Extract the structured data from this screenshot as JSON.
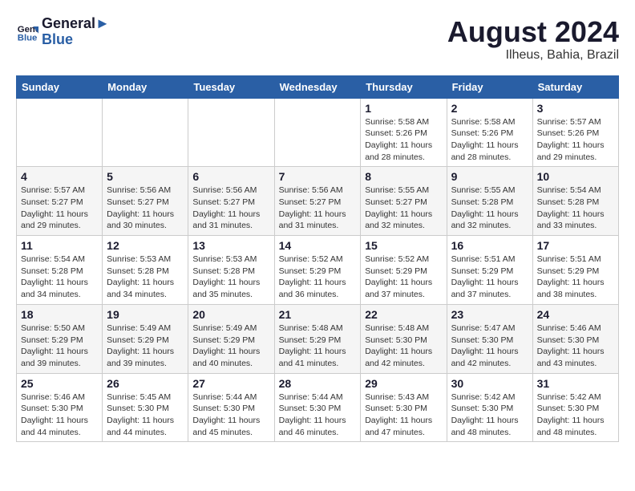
{
  "header": {
    "logo_line1": "General",
    "logo_line2": "Blue",
    "month_year": "August 2024",
    "location": "Ilheus, Bahia, Brazil"
  },
  "weekdays": [
    "Sunday",
    "Monday",
    "Tuesday",
    "Wednesday",
    "Thursday",
    "Friday",
    "Saturday"
  ],
  "weeks": [
    [
      {
        "day": "",
        "info": ""
      },
      {
        "day": "",
        "info": ""
      },
      {
        "day": "",
        "info": ""
      },
      {
        "day": "",
        "info": ""
      },
      {
        "day": "1",
        "info": "Sunrise: 5:58 AM\nSunset: 5:26 PM\nDaylight: 11 hours and 28 minutes."
      },
      {
        "day": "2",
        "info": "Sunrise: 5:58 AM\nSunset: 5:26 PM\nDaylight: 11 hours and 28 minutes."
      },
      {
        "day": "3",
        "info": "Sunrise: 5:57 AM\nSunset: 5:26 PM\nDaylight: 11 hours and 29 minutes."
      }
    ],
    [
      {
        "day": "4",
        "info": "Sunrise: 5:57 AM\nSunset: 5:27 PM\nDaylight: 11 hours and 29 minutes."
      },
      {
        "day": "5",
        "info": "Sunrise: 5:56 AM\nSunset: 5:27 PM\nDaylight: 11 hours and 30 minutes."
      },
      {
        "day": "6",
        "info": "Sunrise: 5:56 AM\nSunset: 5:27 PM\nDaylight: 11 hours and 31 minutes."
      },
      {
        "day": "7",
        "info": "Sunrise: 5:56 AM\nSunset: 5:27 PM\nDaylight: 11 hours and 31 minutes."
      },
      {
        "day": "8",
        "info": "Sunrise: 5:55 AM\nSunset: 5:27 PM\nDaylight: 11 hours and 32 minutes."
      },
      {
        "day": "9",
        "info": "Sunrise: 5:55 AM\nSunset: 5:28 PM\nDaylight: 11 hours and 32 minutes."
      },
      {
        "day": "10",
        "info": "Sunrise: 5:54 AM\nSunset: 5:28 PM\nDaylight: 11 hours and 33 minutes."
      }
    ],
    [
      {
        "day": "11",
        "info": "Sunrise: 5:54 AM\nSunset: 5:28 PM\nDaylight: 11 hours and 34 minutes."
      },
      {
        "day": "12",
        "info": "Sunrise: 5:53 AM\nSunset: 5:28 PM\nDaylight: 11 hours and 34 minutes."
      },
      {
        "day": "13",
        "info": "Sunrise: 5:53 AM\nSunset: 5:28 PM\nDaylight: 11 hours and 35 minutes."
      },
      {
        "day": "14",
        "info": "Sunrise: 5:52 AM\nSunset: 5:29 PM\nDaylight: 11 hours and 36 minutes."
      },
      {
        "day": "15",
        "info": "Sunrise: 5:52 AM\nSunset: 5:29 PM\nDaylight: 11 hours and 37 minutes."
      },
      {
        "day": "16",
        "info": "Sunrise: 5:51 AM\nSunset: 5:29 PM\nDaylight: 11 hours and 37 minutes."
      },
      {
        "day": "17",
        "info": "Sunrise: 5:51 AM\nSunset: 5:29 PM\nDaylight: 11 hours and 38 minutes."
      }
    ],
    [
      {
        "day": "18",
        "info": "Sunrise: 5:50 AM\nSunset: 5:29 PM\nDaylight: 11 hours and 39 minutes."
      },
      {
        "day": "19",
        "info": "Sunrise: 5:49 AM\nSunset: 5:29 PM\nDaylight: 11 hours and 39 minutes."
      },
      {
        "day": "20",
        "info": "Sunrise: 5:49 AM\nSunset: 5:29 PM\nDaylight: 11 hours and 40 minutes."
      },
      {
        "day": "21",
        "info": "Sunrise: 5:48 AM\nSunset: 5:29 PM\nDaylight: 11 hours and 41 minutes."
      },
      {
        "day": "22",
        "info": "Sunrise: 5:48 AM\nSunset: 5:30 PM\nDaylight: 11 hours and 42 minutes."
      },
      {
        "day": "23",
        "info": "Sunrise: 5:47 AM\nSunset: 5:30 PM\nDaylight: 11 hours and 42 minutes."
      },
      {
        "day": "24",
        "info": "Sunrise: 5:46 AM\nSunset: 5:30 PM\nDaylight: 11 hours and 43 minutes."
      }
    ],
    [
      {
        "day": "25",
        "info": "Sunrise: 5:46 AM\nSunset: 5:30 PM\nDaylight: 11 hours and 44 minutes."
      },
      {
        "day": "26",
        "info": "Sunrise: 5:45 AM\nSunset: 5:30 PM\nDaylight: 11 hours and 44 minutes."
      },
      {
        "day": "27",
        "info": "Sunrise: 5:44 AM\nSunset: 5:30 PM\nDaylight: 11 hours and 45 minutes."
      },
      {
        "day": "28",
        "info": "Sunrise: 5:44 AM\nSunset: 5:30 PM\nDaylight: 11 hours and 46 minutes."
      },
      {
        "day": "29",
        "info": "Sunrise: 5:43 AM\nSunset: 5:30 PM\nDaylight: 11 hours and 47 minutes."
      },
      {
        "day": "30",
        "info": "Sunrise: 5:42 AM\nSunset: 5:30 PM\nDaylight: 11 hours and 48 minutes."
      },
      {
        "day": "31",
        "info": "Sunrise: 5:42 AM\nSunset: 5:30 PM\nDaylight: 11 hours and 48 minutes."
      }
    ]
  ]
}
